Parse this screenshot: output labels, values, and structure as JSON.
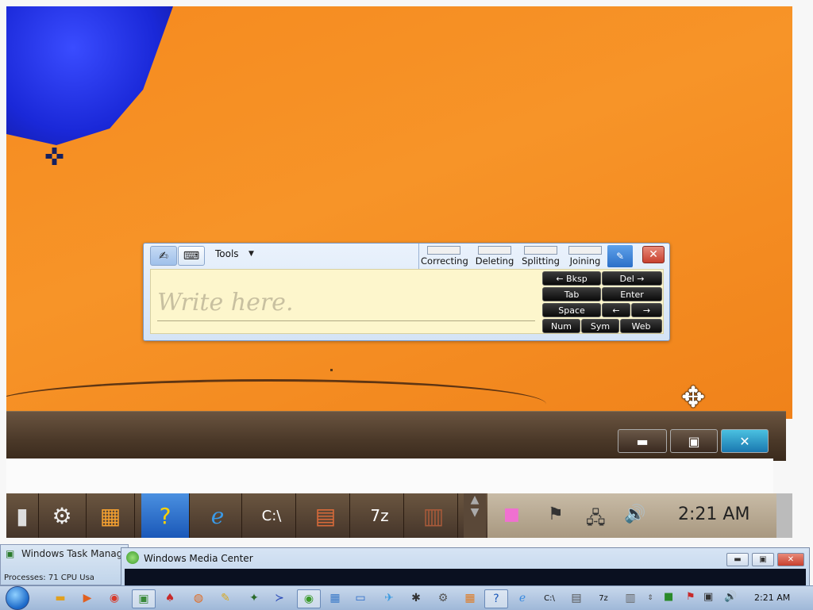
{
  "tablet_input_panel": {
    "tools_label": "Tools",
    "placeholder": "Write here.",
    "gestures": [
      "Correcting",
      "Deleting",
      "Splitting",
      "Joining"
    ],
    "keys": {
      "bksp": "← Bksp",
      "del": "Del →",
      "tab": "Tab",
      "enter": "Enter",
      "space": "Space",
      "left": "←",
      "right": "→",
      "num": "Num",
      "sym": "Sym",
      "web": "Web"
    }
  },
  "zoomed_taskbar": {
    "clock": "2:21 AM"
  },
  "windows": {
    "task_manager_title": "Windows Task Manager",
    "task_manager_status": "Processes: 71    CPU Usa",
    "media_center_title": "Windows Media Center"
  },
  "taskbar": {
    "clock": "2:21 AM"
  },
  "colors": {
    "desktop_orange": "#f58a1f",
    "media_center_brown": "#4a3828",
    "close_red": "#c8402e"
  }
}
